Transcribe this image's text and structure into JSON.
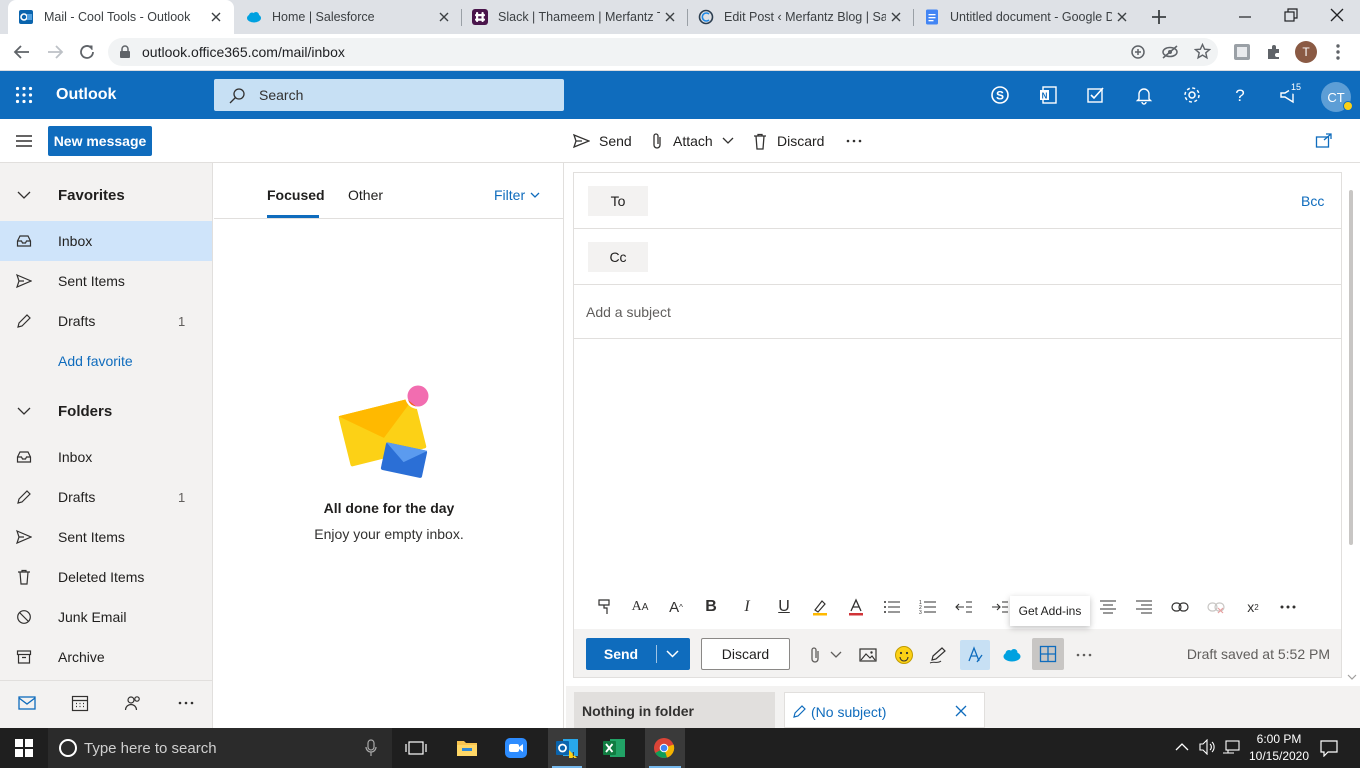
{
  "browser": {
    "tabs": [
      {
        "title": "Mail - Cool Tools - Outlook",
        "icon": "outlook-icon",
        "active": true
      },
      {
        "title": "Home | Salesforce",
        "icon": "salesforce-icon",
        "active": false
      },
      {
        "title": "Slack | Thameem | Merfantz Te",
        "icon": "slack-icon",
        "active": false
      },
      {
        "title": "Edit Post ‹ Merfantz Blog | Sale",
        "icon": "wordpress-icon",
        "active": false
      },
      {
        "title": "Untitled document - Google D",
        "icon": "google-docs-icon",
        "active": false
      }
    ],
    "url": "outlook.office365.com/mail/inbox",
    "profile_initial": "T"
  },
  "header": {
    "app_name": "Outlook",
    "search_placeholder": "Search",
    "notification_count": "15",
    "avatar_initials": "CT"
  },
  "ribbon": {
    "new_message": "New message",
    "send": "Send",
    "attach": "Attach",
    "discard": "Discard"
  },
  "nav": {
    "favorites_label": "Favorites",
    "favorites": [
      {
        "label": "Inbox",
        "count": ""
      },
      {
        "label": "Sent Items",
        "count": ""
      },
      {
        "label": "Drafts",
        "count": "1"
      }
    ],
    "add_favorite": "Add favorite",
    "folders_label": "Folders",
    "folders": [
      {
        "label": "Inbox",
        "count": ""
      },
      {
        "label": "Drafts",
        "count": "1"
      },
      {
        "label": "Sent Items",
        "count": ""
      },
      {
        "label": "Deleted Items",
        "count": ""
      },
      {
        "label": "Junk Email",
        "count": ""
      },
      {
        "label": "Archive",
        "count": ""
      }
    ]
  },
  "message_list": {
    "tab_focused": "Focused",
    "tab_other": "Other",
    "filter": "Filter",
    "empty_title": "All done for the day",
    "empty_subtitle": "Enjoy your empty inbox."
  },
  "compose": {
    "to_label": "To",
    "cc_label": "Cc",
    "bcc_label": "Bcc",
    "subject_placeholder": "Add a subject",
    "send_label": "Send",
    "discard_label": "Discard",
    "tooltip": "Get Add-ins",
    "draft_status": "Draft saved at 5:52 PM"
  },
  "bottom": {
    "nothing_in_folder": "Nothing in folder",
    "draft_tab": "(No subject)"
  },
  "taskbar": {
    "search_placeholder": "Type here to search",
    "time": "6:00 PM",
    "date": "10/15/2020"
  },
  "colors": {
    "brand_blue": "#0f6cbd",
    "selected_nav": "#cfe4fa",
    "link_blue": "#0f6cbd"
  }
}
